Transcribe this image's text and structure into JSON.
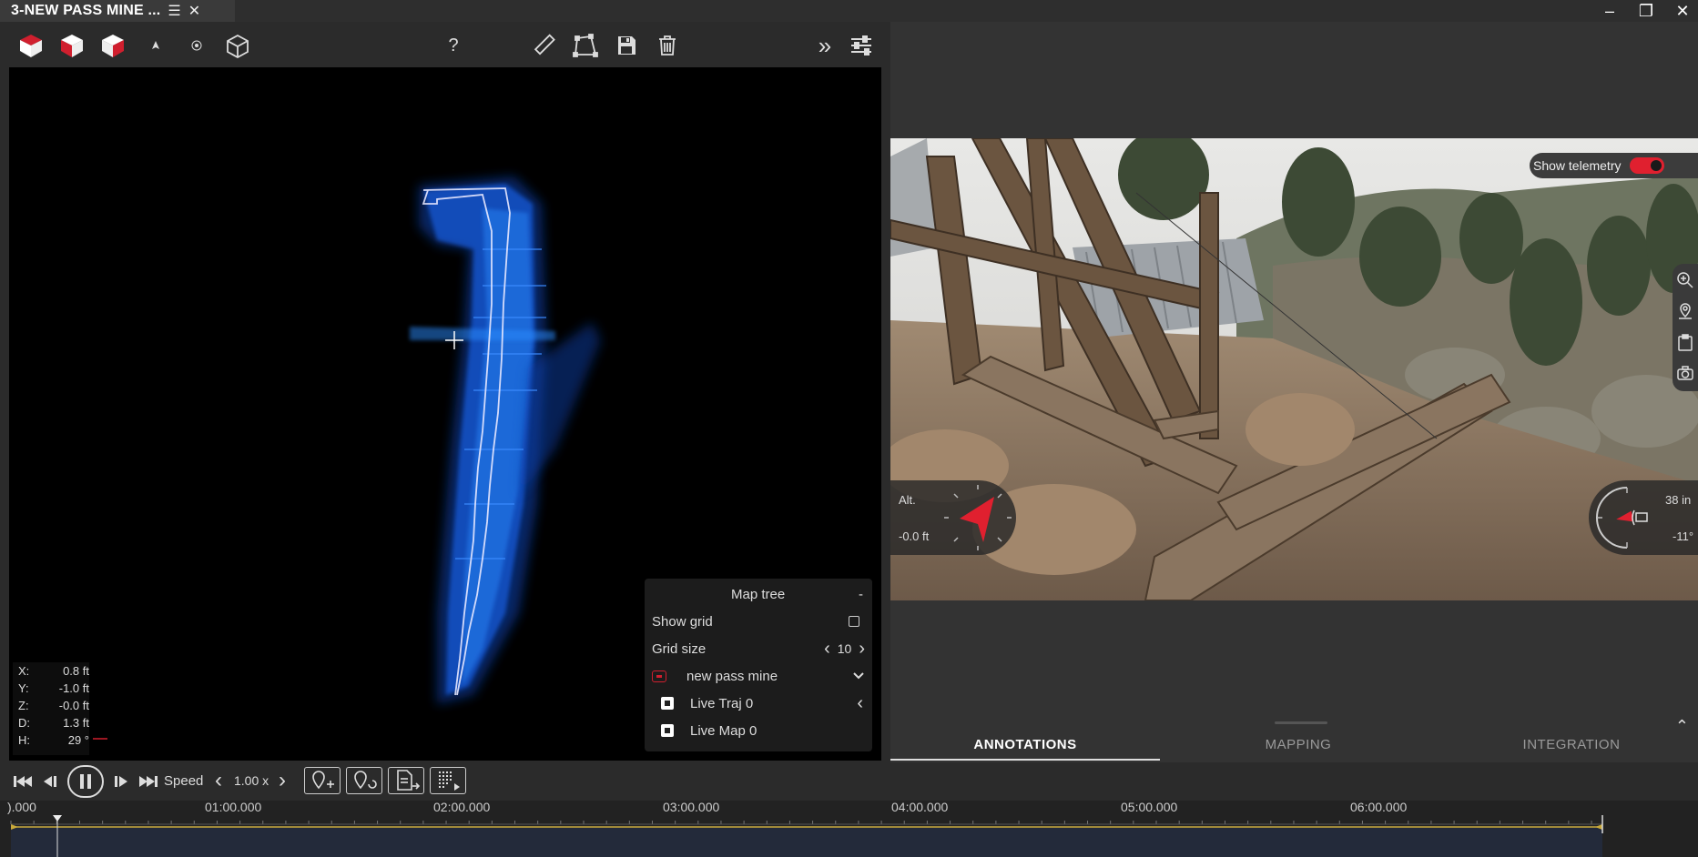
{
  "window": {
    "tab_title": "3-NEW PASS MINE ...",
    "list_icon": "list-icon",
    "close_tab": "✕",
    "minimize": "‒",
    "restore": "❐",
    "close": "✕"
  },
  "toolbar": {
    "help": "?",
    "more": "»"
  },
  "coords": {
    "x_label": "X:",
    "x_value": "0.8 ft",
    "y_label": "Y:",
    "y_value": "-1.0 ft",
    "z_label": "Z:",
    "z_value": "-0.0 ft",
    "d_label": "D:",
    "d_value": "1.3 ft",
    "h_label": "H:",
    "h_value": "29 °"
  },
  "map_tree": {
    "title": "Map tree",
    "collapse": "-",
    "show_grid_label": "Show grid",
    "grid_size_label": "Grid size",
    "grid_size_value": "10",
    "layer_name": "new pass mine",
    "traj_name": "Live Traj 0",
    "map_name": "Live Map 0"
  },
  "telemetry": {
    "label": "Show telemetry",
    "enabled": true,
    "alt_label": "Alt.",
    "alt_value": "-0.0 ft",
    "dist_value": "38 in",
    "pitch_value": "-11°"
  },
  "panel_tabs": {
    "annotations": "ANNOTATIONS",
    "mapping": "MAPPING",
    "integration": "INTEGRATION",
    "active": "ANNOTATIONS"
  },
  "playback": {
    "speed_label": "Speed",
    "speed_value": "1.00 x",
    "is_playing": true
  },
  "timeline": {
    "labels": [
      ").000",
      "01:00.000",
      "02:00.000",
      "03:00.000",
      "04:00.000",
      "05:00.000",
      "06:00.000"
    ]
  },
  "colors": {
    "accent": "#d01f2e",
    "active_tab": "#ffffff",
    "inactive_tab": "#9a9a9a",
    "pointcloud": "#1e6cff"
  }
}
